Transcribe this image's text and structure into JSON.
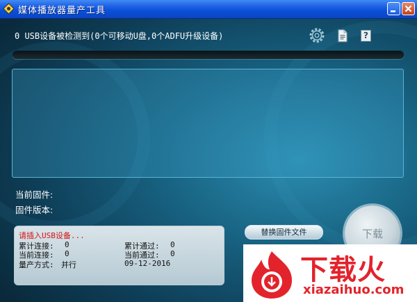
{
  "window": {
    "title": "媒体播放器量产工具"
  },
  "status": {
    "detected_text": "0 USB设备被检测到(0个可移动U盘,0个ADFU升级设备)"
  },
  "toolbar_icons": [
    "gear-icon",
    "document-icon",
    "help-icon"
  ],
  "help_label": "?",
  "firmware": {
    "current_label": "当前固件:",
    "version_label": "固件版本:"
  },
  "info": {
    "prompt": "请插入USB设备...",
    "total_connect_label": "累计连接:",
    "total_connect_value": "0",
    "total_pass_label": "累计通过:",
    "total_pass_value": "0",
    "current_connect_label": "当前连接:",
    "current_connect_value": "0",
    "current_pass_label": "当前通过:",
    "current_pass_value": "0",
    "mode_label": "量产方式:",
    "mode_value": "并行",
    "date": "09-12-2016"
  },
  "buttons": {
    "replace_firmware": "替换固件文件",
    "download": "下载"
  },
  "watermark": {
    "brand": "下载火",
    "url": "xiazaihuo.com"
  },
  "colors": {
    "title_bar": "#0a4fd8",
    "background": "#17607f",
    "prompt": "#d51414",
    "watermark": "#e3232b"
  }
}
